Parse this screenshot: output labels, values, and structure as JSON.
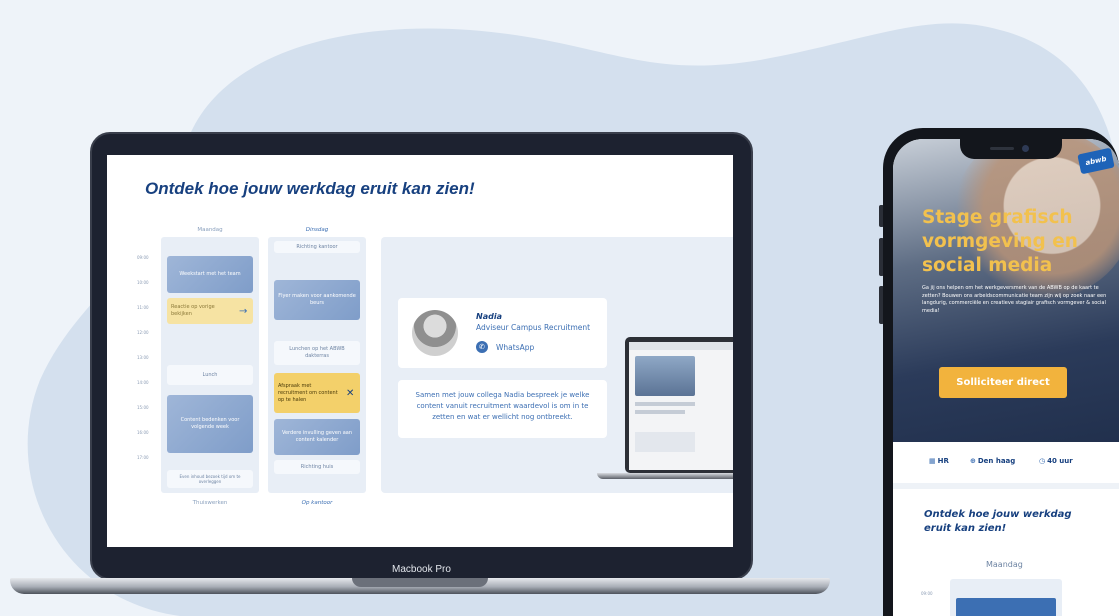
{
  "laptop": {
    "model_label": "Macbook Pro",
    "page_title": "Ontdek hoe jouw werkdag eruit kan zien!",
    "times": [
      "09:00",
      "10:00",
      "11:00",
      "12:00",
      "13:00",
      "14:00",
      "15:00",
      "16:00",
      "17:00"
    ],
    "columns": [
      {
        "header": "Maandag",
        "footer": "Thuiswerken",
        "cards": [
          "Weekstart met het team",
          "Reactie op vorige bekijken",
          "Lunch",
          "Content bedenken voor volgende week",
          "Even inhoud bezoek tijd om te overleggen"
        ]
      },
      {
        "header": "Dinsdag",
        "footer": "Op kantoor",
        "cards": [
          "Richting kantoor",
          "Flyer maken voor aankomende beurs",
          "Lunchen op het ABWB dakterras",
          "Afspraak met recruitment om content op te halen",
          "Verdere invulling geven aan content kalender",
          "Richting huis"
        ]
      }
    ],
    "contact": {
      "name": "Nadia",
      "role": "Adviseur Campus Recruitment",
      "channel": "WhatsApp"
    },
    "message": "Samen met jouw collega Nadia bespreek je welke content vanuit recruitment waardevol is om in te zetten en wat er wellicht nog ontbreekt."
  },
  "phone": {
    "logo": "abwb",
    "hero_title": "Stage grafisch vormgeving en social media",
    "hero_text": "Ga jij ons helpen om het werkgeversmerk van de ABWB op de kaart te zetten? Bouwen ons arbeidscommunicatie team zijn wij op zoek naar een langdurig, commerciële en creatieve stagiair grafisch vormgever & social media!",
    "cta_label": "Solliciteer direct",
    "meta": {
      "dept": "HR",
      "location": "Den haag",
      "hours": "40 uur"
    },
    "section_title": "Ontdek hoe jouw werkdag eruit kan zien!",
    "day_label": "Maandag",
    "first_time": "09:00"
  },
  "colors": {
    "navy": "#17407f",
    "accent_yellow": "#f2b33d",
    "hero_title": "#f2c14e",
    "background_blob": "#d4e0ee"
  }
}
